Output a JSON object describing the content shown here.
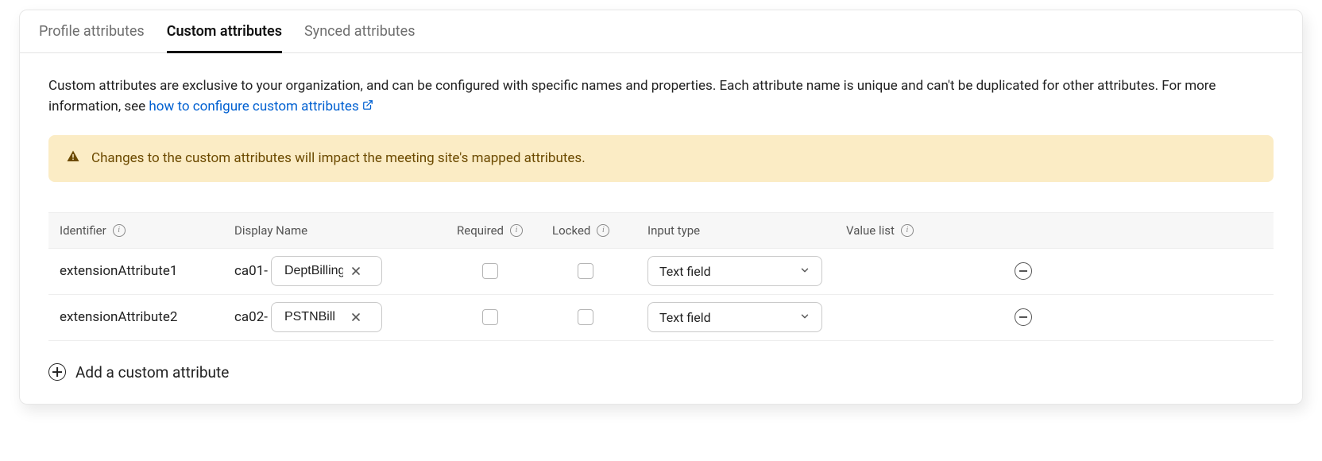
{
  "tabs": {
    "profile": "Profile attributes",
    "custom": "Custom attributes",
    "synced": "Synced attributes"
  },
  "description": {
    "text_before_link": "Custom attributes are exclusive to your organization, and can be configured with specific names and properties. Each attribute name is unique and can't be duplicated for other attributes. For more information, see ",
    "link_text": "how to configure custom attributes"
  },
  "alert": {
    "message": "Changes to the custom attributes will impact the meeting site's mapped attributes."
  },
  "table": {
    "headers": {
      "identifier": "Identifier",
      "display_name": "Display Name",
      "required": "Required",
      "locked": "Locked",
      "input_type": "Input type",
      "value_list": "Value list"
    },
    "rows": [
      {
        "identifier": "extensionAttribute1",
        "prefix": "ca01-",
        "name_value": "DeptBillingCode",
        "input_type": "Text field"
      },
      {
        "identifier": "extensionAttribute2",
        "prefix": "ca02-",
        "name_value": "PSTNBill",
        "input_type": "Text field"
      }
    ]
  },
  "add_button": "Add a custom attribute"
}
